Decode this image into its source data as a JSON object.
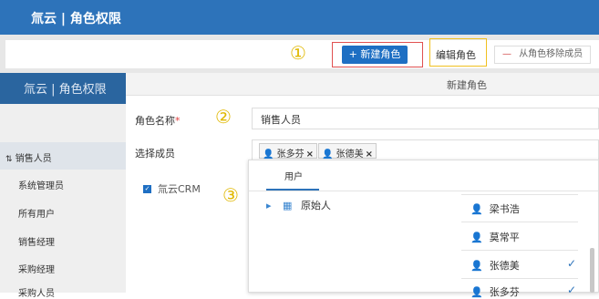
{
  "header": {
    "title": "氚云 | 角色权限"
  },
  "toolbar": {
    "circle1": "①",
    "new_role_icon": "+",
    "new_role_label": "新建角色",
    "edit_role_label": "编辑角色",
    "remove_icon": "—",
    "remove_label": "从角色移除成员"
  },
  "sidebar": {
    "title": "氚云 | 角色权限",
    "collapse_icon": "⇅",
    "items": [
      {
        "label": "销售人员"
      },
      {
        "label": "系统管理员"
      },
      {
        "label": "所有用户"
      },
      {
        "label": "销售经理"
      },
      {
        "label": "采购经理"
      },
      {
        "label": "采购人员"
      }
    ]
  },
  "modal": {
    "title": "新建角色",
    "name_label": "角色名称",
    "name_required": "*",
    "circle2": "②",
    "name_value": "销售人员",
    "members_label": "选择成员",
    "tags": [
      {
        "label": "张多芬",
        "remove": "×"
      },
      {
        "label": "张德美",
        "remove": "×"
      }
    ],
    "tree_checkbox": "✓",
    "tree_label": "氚云CRM",
    "circle3": "③"
  },
  "picker": {
    "tab_label": "用户",
    "org_arrow": "▸",
    "org_label": "原始人",
    "users": [
      {
        "name": "梁书浩",
        "checked": ""
      },
      {
        "name": "莫常平",
        "checked": ""
      },
      {
        "name": "张德美",
        "checked": "✓"
      },
      {
        "name": "张多芬",
        "checked": "✓"
      }
    ]
  }
}
